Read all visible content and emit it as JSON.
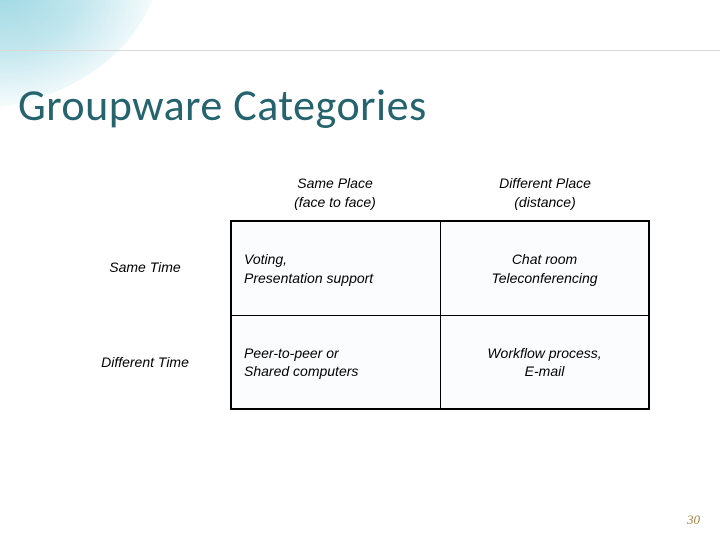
{
  "title": "Groupware Categories",
  "matrix": {
    "col_headers": [
      {
        "line1": "Same Place",
        "line2": "(face to face)"
      },
      {
        "line1": "Different Place",
        "line2": "(distance)"
      }
    ],
    "row_headers": [
      "Same Time",
      "Different Time"
    ],
    "cells": [
      [
        {
          "line1": "Voting,",
          "line2": "Presentation support"
        },
        {
          "line1": "Chat room",
          "line2": "Teleconferencing"
        }
      ],
      [
        {
          "line1": "Peer-to-peer or",
          "line2": "Shared computers"
        },
        {
          "line1": "Workflow process,",
          "line2": "E-mail"
        }
      ]
    ]
  },
  "page_number": "30"
}
